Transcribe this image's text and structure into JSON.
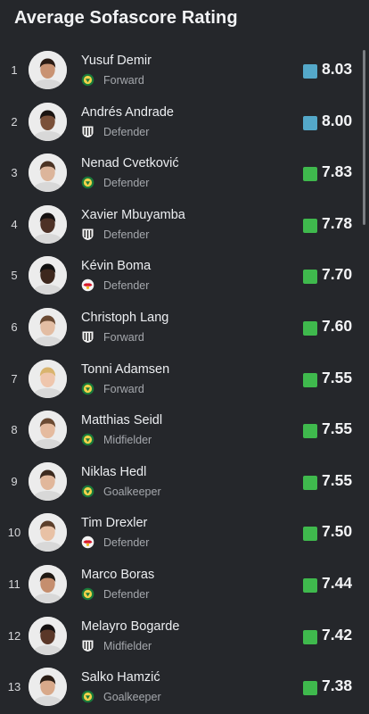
{
  "header": {
    "title": "Average Sofascore Rating"
  },
  "colors": {
    "top_rating": "#54a8c9",
    "high_rating": "#3fb94d"
  },
  "players": [
    {
      "rank": "1",
      "name": "Yusuf Demir",
      "position": "Forward",
      "rating": "8.03",
      "club_icon": "rapid-crest-icon",
      "rating_color": "#54a8c9",
      "skin": "#c99373",
      "hair": "#2b1c14"
    },
    {
      "rank": "2",
      "name": "Andrés Andrade",
      "position": "Defender",
      "rating": "8.00",
      "club_icon": "lask-crest-icon",
      "rating_color": "#54a8c9",
      "skin": "#7a5039",
      "hair": "#1b1411"
    },
    {
      "rank": "3",
      "name": "Nenad Cvetković",
      "position": "Defender",
      "rating": "7.83",
      "club_icon": "rapid-crest-icon",
      "rating_color": "#3fb94d",
      "skin": "#dcb59b",
      "hair": "#4b3324"
    },
    {
      "rank": "4",
      "name": "Xavier Mbuyamba",
      "position": "Defender",
      "rating": "7.78",
      "club_icon": "lask-crest-icon",
      "rating_color": "#3fb94d",
      "skin": "#4d3126",
      "hair": "#161111"
    },
    {
      "rank": "5",
      "name": "Kévin Boma",
      "position": "Defender",
      "rating": "7.70",
      "club_icon": "salzburg-crest-icon",
      "rating_color": "#3fb94d",
      "skin": "#3d271d",
      "hair": "#111"
    },
    {
      "rank": "6",
      "name": "Christoph Lang",
      "position": "Forward",
      "rating": "7.60",
      "club_icon": "lask-crest-icon",
      "rating_color": "#3fb94d",
      "skin": "#e3bda3",
      "hair": "#6a4a33"
    },
    {
      "rank": "7",
      "name": "Tonni Adamsen",
      "position": "Forward",
      "rating": "7.55",
      "club_icon": "rapid-crest-icon",
      "rating_color": "#3fb94d",
      "skin": "#efc6ad",
      "hair": "#d9b46e"
    },
    {
      "rank": "8",
      "name": "Matthias Seidl",
      "position": "Midfielder",
      "rating": "7.55",
      "club_icon": "rapid-crest-icon",
      "rating_color": "#3fb94d",
      "skin": "#e5bb9f",
      "hair": "#6b4a32"
    },
    {
      "rank": "9",
      "name": "Niklas Hedl",
      "position": "Goalkeeper",
      "rating": "7.55",
      "club_icon": "rapid-crest-icon",
      "rating_color": "#3fb94d",
      "skin": "#e1b79b",
      "hair": "#3c2a1f"
    },
    {
      "rank": "10",
      "name": "Tim Drexler",
      "position": "Defender",
      "rating": "7.50",
      "club_icon": "salzburg-crest-icon",
      "rating_color": "#3fb94d",
      "skin": "#e8c1a5",
      "hair": "#5c3f2b"
    },
    {
      "rank": "11",
      "name": "Marco Boras",
      "position": "Defender",
      "rating": "7.44",
      "club_icon": "rapid-crest-icon",
      "rating_color": "#3fb94d",
      "skin": "#c58e6e",
      "hair": "#1f1812"
    },
    {
      "rank": "12",
      "name": "Melayro Bogarde",
      "position": "Midfielder",
      "rating": "7.42",
      "club_icon": "lask-crest-icon",
      "rating_color": "#3fb94d",
      "skin": "#5a3728",
      "hair": "#141010"
    },
    {
      "rank": "13",
      "name": "Salko Hamzić",
      "position": "Goalkeeper",
      "rating": "7.38",
      "club_icon": "rapid-crest-icon",
      "rating_color": "#3fb94d",
      "skin": "#d8a98a",
      "hair": "#2a1d15"
    }
  ]
}
